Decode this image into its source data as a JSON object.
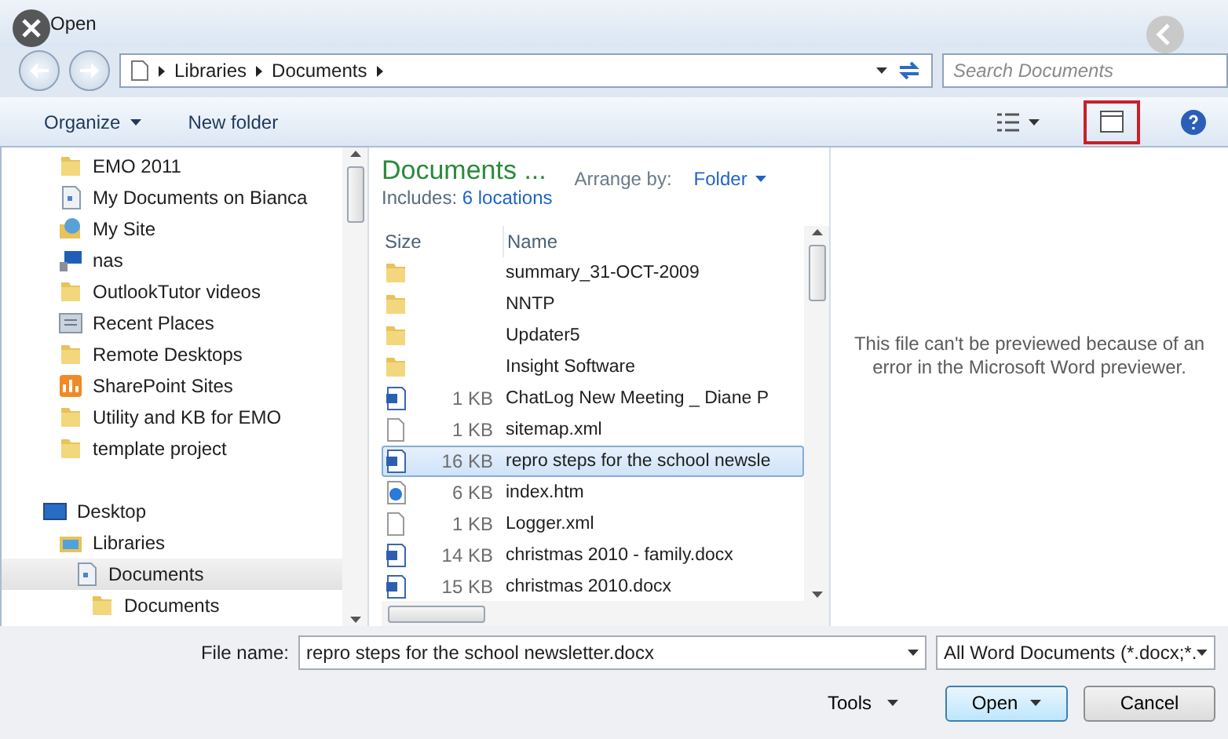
{
  "window": {
    "title": "Open"
  },
  "address": {
    "crumbs": [
      "Libraries",
      "Documents"
    ]
  },
  "search": {
    "placeholder": "Search Documents"
  },
  "toolbar": {
    "organize": "Organize",
    "new_folder": "New folder",
    "preview_pane_on": true
  },
  "nav": {
    "items": [
      {
        "label": "EMO 2011",
        "kind": "folder",
        "selected": false
      },
      {
        "label": "My Documents on Bianca",
        "kind": "library",
        "selected": false
      },
      {
        "label": "My Site",
        "kind": "site",
        "selected": false
      },
      {
        "label": "nas",
        "kind": "computer",
        "selected": false
      },
      {
        "label": "OutlookTutor videos",
        "kind": "folder",
        "selected": false
      },
      {
        "label": "Recent Places",
        "kind": "recent",
        "selected": false
      },
      {
        "label": "Remote Desktops",
        "kind": "folder",
        "selected": false
      },
      {
        "label": "SharePoint Sites",
        "kind": "sharepoint",
        "selected": false
      },
      {
        "label": "Utility and KB for EMO",
        "kind": "folder",
        "selected": false
      },
      {
        "label": "template project",
        "kind": "folder",
        "selected": false
      }
    ],
    "tree": [
      {
        "label": "Desktop",
        "kind": "desktop",
        "selected": false,
        "children": [
          {
            "label": "Libraries",
            "kind": "libraries",
            "selected": false,
            "children": [
              {
                "label": "Documents",
                "kind": "library",
                "selected": true,
                "children": [
                  {
                    "label": "Documents",
                    "kind": "folder",
                    "selected": false
                  }
                ]
              }
            ]
          }
        ]
      }
    ]
  },
  "library": {
    "title": "Documents ...",
    "includes_label": "Includes:",
    "includes_link": "6 locations",
    "arrange_label": "Arrange by:",
    "arrange_value": "Folder"
  },
  "files": {
    "columns": [
      "Size",
      "Name"
    ],
    "rows": [
      {
        "kind": "folder",
        "name": "summary_31-OCT-2009",
        "selected": false
      },
      {
        "kind": "folder",
        "name": "NNTP",
        "selected": false
      },
      {
        "kind": "folder",
        "name": "Updater5",
        "selected": false
      },
      {
        "kind": "folder",
        "name": "Insight Software",
        "selected": false
      },
      {
        "kind": "word",
        "size": "1 KB",
        "name": "ChatLog New Meeting _ Diane P",
        "selected": false
      },
      {
        "kind": "file",
        "size": "1 KB",
        "name": "sitemap.xml",
        "selected": false
      },
      {
        "kind": "word",
        "size": "16 KB",
        "name": "repro steps for the school newsle",
        "selected": true
      },
      {
        "kind": "html",
        "size": "6 KB",
        "name": "index.htm",
        "selected": false
      },
      {
        "kind": "file",
        "size": "1 KB",
        "name": "Logger.xml",
        "selected": false
      },
      {
        "kind": "word",
        "size": "14 KB",
        "name": "christmas 2010 - family.docx",
        "selected": false
      },
      {
        "kind": "word",
        "size": "15 KB",
        "name": "christmas 2010.docx",
        "selected": false
      }
    ]
  },
  "preview": {
    "message": "This file can't be previewed because of an error in the Microsoft Word previewer."
  },
  "footer": {
    "file_name_label": "File name:",
    "file_name": "repro steps for the school newsletter.docx",
    "file_type": "All Word Documents (*.docx;*.",
    "tools": "Tools",
    "open": "Open",
    "cancel": "Cancel"
  }
}
